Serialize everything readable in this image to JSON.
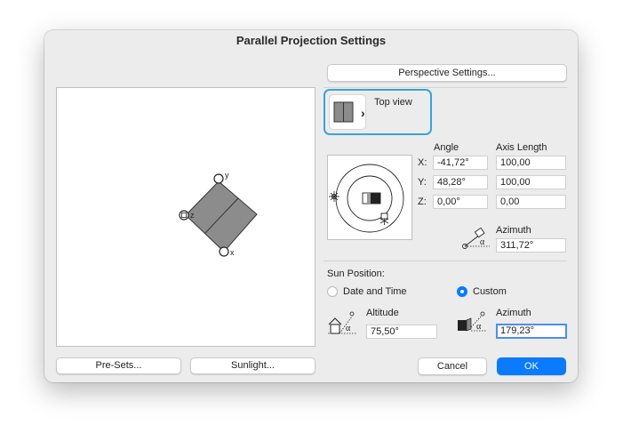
{
  "dialog": {
    "title": "Parallel Projection Settings"
  },
  "buttons": {
    "perspective_settings": "Perspective Settings...",
    "presets": "Pre-Sets...",
    "sunlight": "Sunlight...",
    "cancel": "Cancel",
    "ok": "OK"
  },
  "view_selector": {
    "label": "Top view",
    "chevron": "›"
  },
  "preview_axes": {
    "y": "y",
    "z": "z",
    "x": "x"
  },
  "angle": {
    "angle_header": "Angle",
    "axis_length_header": "Axis Length",
    "rows": [
      {
        "label": "X:",
        "angle": "-41,72°",
        "length": "100,00"
      },
      {
        "label": "Y:",
        "angle": "48,28°",
        "length": "100,00"
      },
      {
        "label": "Z:",
        "angle": "0,00°",
        "length": "0,00"
      }
    ],
    "azimuth_label": "Azimuth",
    "azimuth_value": "311,72°"
  },
  "sun": {
    "section_label": "Sun Position:",
    "option_date_time": "Date and Time",
    "option_custom": "Custom",
    "selected": "Custom",
    "altitude_label": "Altitude",
    "altitude_value": "75,50°",
    "azimuth_label": "Azimuth",
    "azimuth_value": "179,23°",
    "alpha": "α"
  },
  "colors": {
    "accent": "#0a7aff",
    "focus_ring": "#3aa3d9"
  }
}
